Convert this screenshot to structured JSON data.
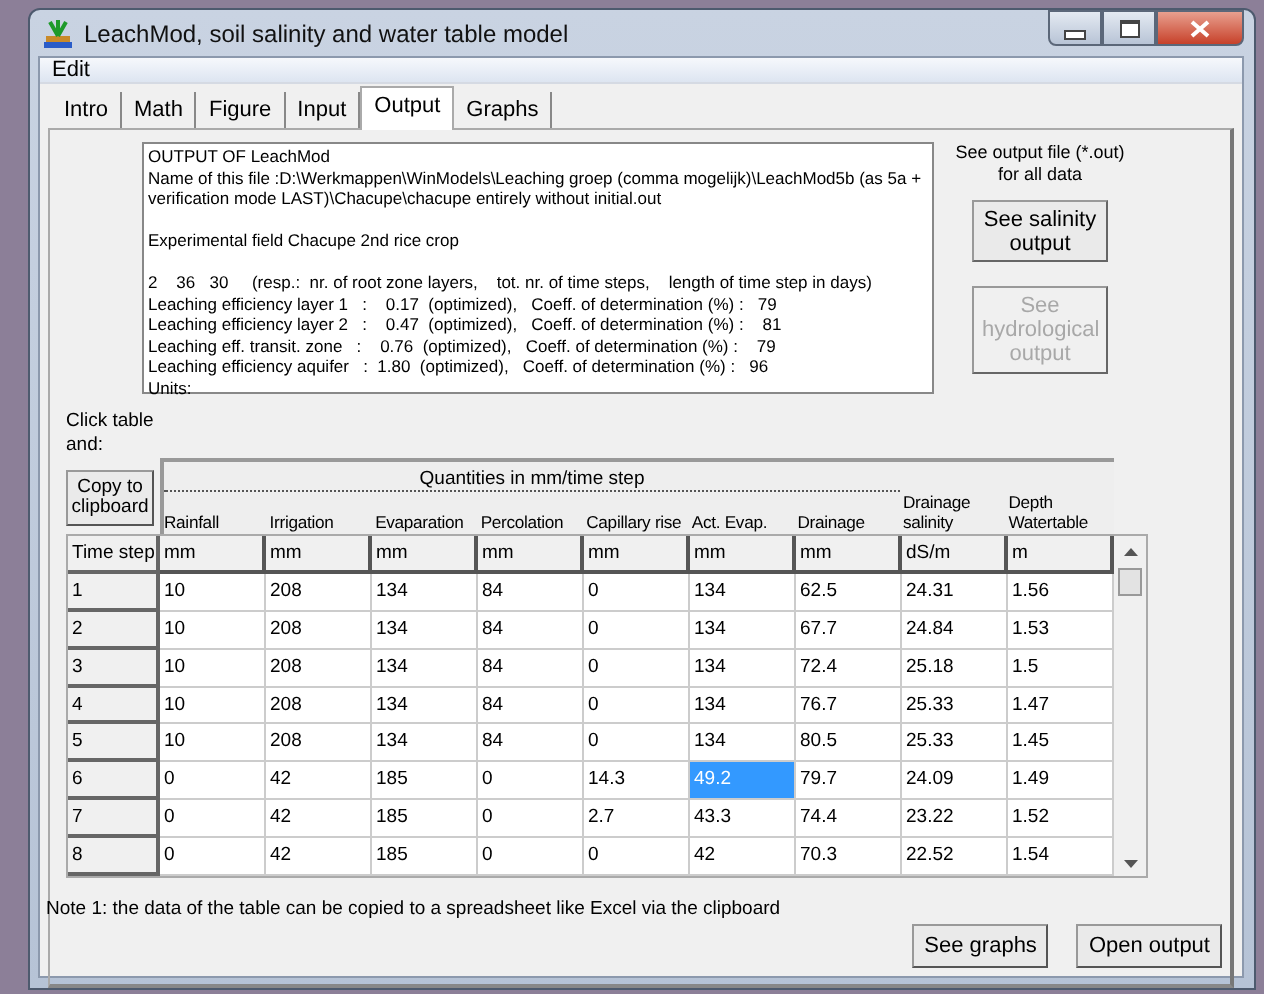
{
  "window": {
    "title": "LeachMod, soil salinity and water table model"
  },
  "menu": [
    {
      "label": "Edit"
    }
  ],
  "tabs": [
    {
      "label": "Intro",
      "selected": false
    },
    {
      "label": "Math",
      "selected": false
    },
    {
      "label": "Figure",
      "selected": false
    },
    {
      "label": "Input",
      "selected": false
    },
    {
      "label": "Output",
      "selected": true
    },
    {
      "label": "Graphs",
      "selected": false
    }
  ],
  "output_text": [
    [
      "OUTPUT OF LeachMod",
      "Name of this file :D:\\Werkmappen\\WinModels\\Leaching groep (comma mogelijk)\\LeachMod5b (as 5a +",
      "verification mode LAST)\\Chacupe\\chacupe entirely without initial.out"
    ],
    [
      "Experimental field Chacupe 2nd rice crop"
    ],
    [
      "2    36   30     (resp.:  nr. of root zone layers,    tot. nr. of time steps,    length of time step in days)",
      "Leaching efficiency layer 1   :    0.17  (optimized),   Coeff. of determination (%) :   79",
      "Leaching efficiency layer 2   :    0.47  (optimized),   Coeff. of determination (%) :    81",
      "Leaching eff. transit. zone   :    0.76  (optimized),   Coeff. of determination (%) :    79",
      "Leaching efficiency aquifer   :  1.80  (optimized),   Coeff. of determination (%) :   96",
      "Units:"
    ]
  ],
  "side_note": "See output file (*.out) for all data",
  "side_buttons": [
    {
      "label": "See salinity output",
      "disabled": false
    },
    {
      "label": "See hydrological output",
      "disabled": true
    }
  ],
  "click_hint": "Click table and:",
  "copy_button": "Copy to clipboard",
  "table": {
    "group_header": "Quantities in mm/time step",
    "columns": [
      "Rainfall",
      "Irrigation",
      "Evaparation",
      "Percolation",
      "Capillary rise",
      "Act. Evap.",
      "Drainage",
      "Drainage salinity",
      "Depth Watertable"
    ],
    "row_header": "Time step",
    "units": [
      "mm",
      "mm",
      "mm",
      "mm",
      "mm",
      "mm",
      "mm",
      "dS/m",
      "m"
    ],
    "rows": [
      {
        "step": "1",
        "cells": [
          {
            "text": "10",
            "selected": false
          },
          {
            "text": "208",
            "selected": false
          },
          {
            "text": "134",
            "selected": false
          },
          {
            "text": "84",
            "selected": false
          },
          {
            "text": "0",
            "selected": false
          },
          {
            "text": "134",
            "selected": false
          },
          {
            "text": "62.5",
            "selected": false
          },
          {
            "text": "24.31",
            "selected": false
          },
          {
            "text": "1.56",
            "selected": false
          }
        ]
      },
      {
        "step": "2",
        "cells": [
          {
            "text": "10",
            "selected": false
          },
          {
            "text": "208",
            "selected": false
          },
          {
            "text": "134",
            "selected": false
          },
          {
            "text": "84",
            "selected": false
          },
          {
            "text": "0",
            "selected": false
          },
          {
            "text": "134",
            "selected": false
          },
          {
            "text": "67.7",
            "selected": false
          },
          {
            "text": "24.84",
            "selected": false
          },
          {
            "text": "1.53",
            "selected": false
          }
        ]
      },
      {
        "step": "3",
        "cells": [
          {
            "text": "10",
            "selected": false
          },
          {
            "text": "208",
            "selected": false
          },
          {
            "text": "134",
            "selected": false
          },
          {
            "text": "84",
            "selected": false
          },
          {
            "text": "0",
            "selected": false
          },
          {
            "text": "134",
            "selected": false
          },
          {
            "text": "72.4",
            "selected": false
          },
          {
            "text": "25.18",
            "selected": false
          },
          {
            "text": "1.5",
            "selected": false
          }
        ]
      },
      {
        "step": "4",
        "cells": [
          {
            "text": "10",
            "selected": false
          },
          {
            "text": "208",
            "selected": false
          },
          {
            "text": "134",
            "selected": false
          },
          {
            "text": "84",
            "selected": false
          },
          {
            "text": "0",
            "selected": false
          },
          {
            "text": "134",
            "selected": false
          },
          {
            "text": "76.7",
            "selected": false
          },
          {
            "text": "25.33",
            "selected": false
          },
          {
            "text": "1.47",
            "selected": false
          }
        ]
      },
      {
        "step": "5",
        "cells": [
          {
            "text": "10",
            "selected": false
          },
          {
            "text": "208",
            "selected": false
          },
          {
            "text": "134",
            "selected": false
          },
          {
            "text": "84",
            "selected": false
          },
          {
            "text": "0",
            "selected": false
          },
          {
            "text": "134",
            "selected": false
          },
          {
            "text": "80.5",
            "selected": false
          },
          {
            "text": "25.33",
            "selected": false
          },
          {
            "text": "1.45",
            "selected": false
          }
        ]
      },
      {
        "step": "6",
        "cells": [
          {
            "text": "0",
            "selected": false
          },
          {
            "text": "42",
            "selected": false
          },
          {
            "text": "185",
            "selected": false
          },
          {
            "text": "0",
            "selected": false
          },
          {
            "text": "14.3",
            "selected": false
          },
          {
            "text": "49.2",
            "selected": true
          },
          {
            "text": "79.7",
            "selected": false
          },
          {
            "text": "24.09",
            "selected": false
          },
          {
            "text": "1.49",
            "selected": false
          }
        ]
      },
      {
        "step": "7",
        "cells": [
          {
            "text": "0",
            "selected": false
          },
          {
            "text": "42",
            "selected": false
          },
          {
            "text": "185",
            "selected": false
          },
          {
            "text": "0",
            "selected": false
          },
          {
            "text": "2.7",
            "selected": false
          },
          {
            "text": "43.3",
            "selected": false
          },
          {
            "text": "74.4",
            "selected": false
          },
          {
            "text": "23.22",
            "selected": false
          },
          {
            "text": "1.52",
            "selected": false
          }
        ]
      },
      {
        "step": "8",
        "cells": [
          {
            "text": "0",
            "selected": false
          },
          {
            "text": "42",
            "selected": false
          },
          {
            "text": "185",
            "selected": false
          },
          {
            "text": "0",
            "selected": false
          },
          {
            "text": "0",
            "selected": false
          },
          {
            "text": "42",
            "selected": false
          },
          {
            "text": "70.3",
            "selected": false
          },
          {
            "text": "22.52",
            "selected": false
          },
          {
            "text": "1.54",
            "selected": false
          }
        ]
      }
    ]
  },
  "note": "Note 1: the data of the table can be copied to a spreadsheet like Excel via the clipboard",
  "bottom_buttons": [
    {
      "label": "See graphs"
    },
    {
      "label": "Open output"
    }
  ]
}
